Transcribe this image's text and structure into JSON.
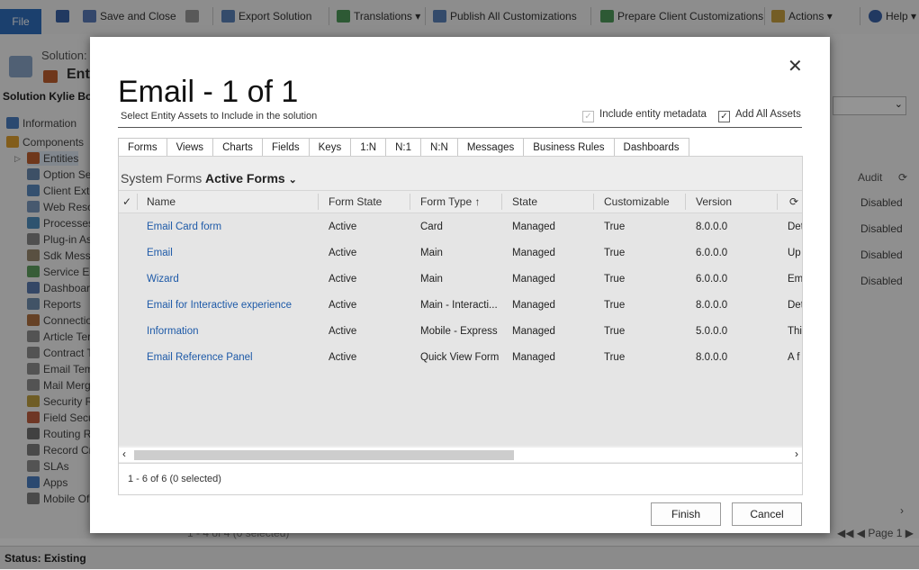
{
  "ribbon": {
    "file": "File",
    "save_and_close": "Save and Close",
    "export_solution": "Export Solution",
    "translations": "Translations",
    "publish_all": "Publish All Customizations",
    "prepare_client": "Prepare Client Customizations",
    "actions": "Actions",
    "help": "Help"
  },
  "app": {
    "solution_label": "Solution:",
    "solution_title": "Enti",
    "solution_name": "Solution Kylie Bot",
    "status": "Status: Existing",
    "bg_records": "1 - 4 of 4 (0 selected)",
    "bg_paging": "Page 1",
    "bg_grid_header": "Audit",
    "bg_grid_cells": [
      "Disabled",
      "Disabled",
      "Disabled",
      "Disabled"
    ]
  },
  "nav": [
    {
      "label": "Information",
      "icon": "info-icon",
      "color": "#4a7fc1"
    },
    {
      "label": "Components",
      "icon": "components-icon",
      "color": "#e0a030"
    },
    {
      "label": "Entities",
      "icon": "entities-icon",
      "color": "#c06030"
    },
    {
      "label": "Option Se",
      "icon": "option-set-icon",
      "color": "#6a8ab0"
    },
    {
      "label": "Client Exte",
      "icon": "client-extension-icon",
      "color": "#5a8ac0"
    },
    {
      "label": "Web Reso",
      "icon": "web-resource-icon",
      "color": "#7a9ac0"
    },
    {
      "label": "Processes",
      "icon": "process-icon",
      "color": "#5090c0"
    },
    {
      "label": "Plug-in As",
      "icon": "plugin-icon",
      "color": "#888888"
    },
    {
      "label": "Sdk Messa",
      "icon": "sdk-message-icon",
      "color": "#9a8a70"
    },
    {
      "label": "Service En",
      "icon": "service-endpoint-icon",
      "color": "#60a060"
    },
    {
      "label": "Dashboard",
      "icon": "dashboard-icon",
      "color": "#5a7ab0"
    },
    {
      "label": "Reports",
      "icon": "report-icon",
      "color": "#7090b0"
    },
    {
      "label": "Connectio",
      "icon": "connection-icon",
      "color": "#b07040"
    },
    {
      "label": "Article Ter",
      "icon": "article-template-icon",
      "color": "#909090"
    },
    {
      "label": "Contract Te",
      "icon": "contract-template-icon",
      "color": "#909090"
    },
    {
      "label": "Email Temp",
      "icon": "email-template-icon",
      "color": "#909090"
    },
    {
      "label": "Mail Merg",
      "icon": "mail-merge-icon",
      "color": "#909090"
    },
    {
      "label": "Security Ro",
      "icon": "security-role-icon",
      "color": "#c0a040"
    },
    {
      "label": "Field Secu",
      "icon": "field-security-icon",
      "color": "#c06040"
    },
    {
      "label": "Routing R",
      "icon": "routing-rule-icon",
      "color": "#707070"
    },
    {
      "label": "Record Cre",
      "icon": "record-creation-icon",
      "color": "#808080"
    },
    {
      "label": "SLAs",
      "icon": "sla-icon",
      "color": "#909090"
    },
    {
      "label": "Apps",
      "icon": "apps-icon",
      "color": "#4a7fc1"
    },
    {
      "label": "Mobile Of",
      "icon": "mobile-offline-icon",
      "color": "#808080"
    }
  ],
  "dialog": {
    "title": "Email - 1 of 1",
    "subtitle": "Select Entity Assets to Include in the solution",
    "include_metadata": "Include entity metadata",
    "add_all_assets": "Add All Assets",
    "tabs": [
      "Forms",
      "Views",
      "Charts",
      "Fields",
      "Keys",
      "1:N",
      "N:1",
      "N:N",
      "Messages",
      "Business Rules",
      "Dashboards"
    ],
    "view_label": "System Forms",
    "view_select": "Active Forms",
    "columns": [
      "Name",
      "Form State",
      "Form Type",
      "State",
      "Customizable",
      "Version"
    ],
    "rows": [
      {
        "name": "Email Card form",
        "state_form": "Active",
        "type": "Card",
        "state": "Managed",
        "customizable": "True",
        "version": "8.0.0.0",
        "desc": "Det"
      },
      {
        "name": "Email",
        "state_form": "Active",
        "type": "Main",
        "state": "Managed",
        "customizable": "True",
        "version": "6.0.0.0",
        "desc": "Up"
      },
      {
        "name": "Wizard",
        "state_form": "Active",
        "type": "Main",
        "state": "Managed",
        "customizable": "True",
        "version": "6.0.0.0",
        "desc": "Em"
      },
      {
        "name": "Email for Interactive experience",
        "state_form": "Active",
        "type": "Main - Interacti...",
        "state": "Managed",
        "customizable": "True",
        "version": "8.0.0.0",
        "desc": "Det"
      },
      {
        "name": "Information",
        "state_form": "Active",
        "type": "Mobile - Express",
        "state": "Managed",
        "customizable": "True",
        "version": "5.0.0.0",
        "desc": "Thi"
      },
      {
        "name": "Email Reference Panel",
        "state_form": "Active",
        "type": "Quick View Form",
        "state": "Managed",
        "customizable": "True",
        "version": "8.0.0.0",
        "desc": "A f"
      }
    ],
    "footer": "1 - 6 of 6 (0 selected)",
    "finish": "Finish",
    "cancel": "Cancel"
  }
}
